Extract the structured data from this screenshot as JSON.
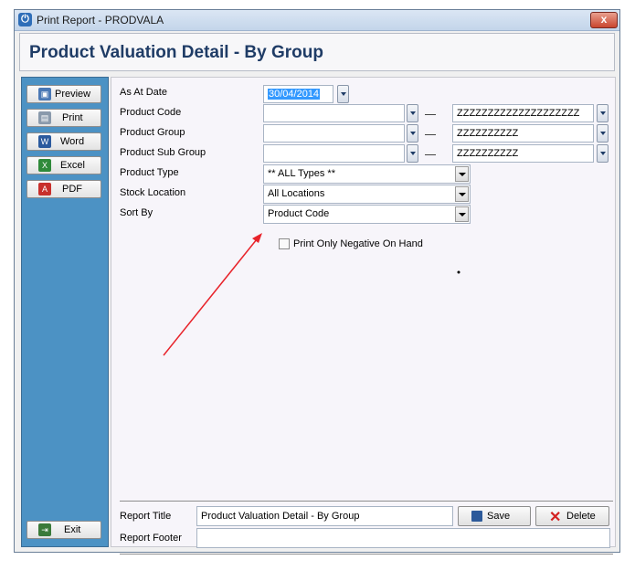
{
  "window": {
    "title": "Print Report - PRODVALA",
    "close_label": "x"
  },
  "header": {
    "title": "Product Valuation Detail - By Group"
  },
  "sidebar": {
    "buttons": [
      {
        "label": "Preview",
        "icon": "preview-icon"
      },
      {
        "label": "Print",
        "icon": "printer-icon"
      },
      {
        "label": "Word",
        "icon": "word-icon"
      },
      {
        "label": "Excel",
        "icon": "excel-icon"
      },
      {
        "label": "PDF",
        "icon": "pdf-icon"
      }
    ],
    "exit_label": "Exit"
  },
  "form": {
    "as_at_date": {
      "label": "As At Date",
      "value": "30/04/2014"
    },
    "product_code": {
      "label": "Product Code",
      "from": "",
      "to": "ZZZZZZZZZZZZZZZZZZZZ"
    },
    "product_group": {
      "label": "Product Group",
      "from": "",
      "to": "ZZZZZZZZZZ"
    },
    "product_sub_group": {
      "label": "Product Sub Group",
      "from": "",
      "to": "ZZZZZZZZZZ"
    },
    "product_type": {
      "label": "Product Type",
      "value": "** ALL Types **"
    },
    "stock_location": {
      "label": "Stock Location",
      "value": "All Locations"
    },
    "sort_by": {
      "label": "Sort By",
      "value": "Product Code"
    },
    "negative_checkbox": {
      "label": "Print Only Negative On Hand",
      "checked": false
    }
  },
  "footer": {
    "report_title_label": "Report Title",
    "report_title_value": "Product Valuation Detail - By Group",
    "report_footer_label": "Report Footer",
    "report_footer_value": "",
    "save_label": "Save",
    "delete_label": "Delete"
  },
  "colors": {
    "sidebar": "#4c92c4",
    "title": "#1f3c66",
    "annotation_arrow": "#e8232a",
    "selection": "#3399ff"
  }
}
